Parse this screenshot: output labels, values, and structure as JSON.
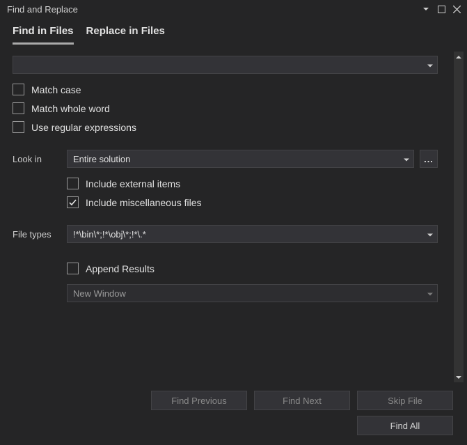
{
  "titlebar": {
    "title": "Find and Replace"
  },
  "tabs": {
    "find_in_files": "Find in Files",
    "replace_in_files": "Replace in Files"
  },
  "search": {
    "value": ""
  },
  "options": {
    "match_case": "Match case",
    "match_whole_word": "Match whole word",
    "use_regex": "Use regular expressions"
  },
  "look_in": {
    "label": "Look in",
    "value": "Entire solution",
    "browse": "...",
    "include_external": "Include external items",
    "include_misc": "Include miscellaneous files"
  },
  "file_types": {
    "label": "File types",
    "value": "!*\\bin\\*;!*\\obj\\*;!*\\.*"
  },
  "results": {
    "append": "Append Results",
    "window": "New Window"
  },
  "buttons": {
    "find_previous": "Find Previous",
    "find_next": "Find Next",
    "skip_file": "Skip File",
    "find_all": "Find All"
  }
}
